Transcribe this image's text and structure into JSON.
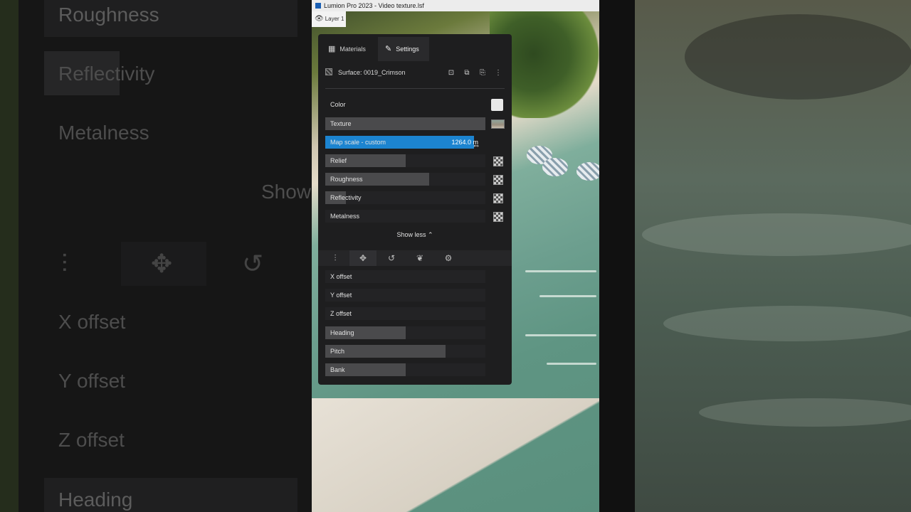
{
  "window": {
    "title": "Lumion Pro 2023 - Video texture.lsf"
  },
  "layer": {
    "label": "Layer 1"
  },
  "panel": {
    "tabs": [
      {
        "label": "Materials",
        "icon": "grid-icon"
      },
      {
        "label": "Settings",
        "icon": "pencil-icon"
      }
    ],
    "surface": {
      "name": "Surface: 0019_Crimson"
    },
    "properties": {
      "color": {
        "label": "Color"
      },
      "texture": {
        "label": "Texture"
      },
      "map_scale": {
        "label": "Map scale - custom",
        "value": "1264.0 m",
        "level": 0.93
      },
      "relief": {
        "label": "Relief",
        "level": 0.5
      },
      "roughness": {
        "label": "Roughness",
        "level": 0.65
      },
      "reflectivity": {
        "label": "Reflectivity",
        "level": 0.13
      },
      "metalness": {
        "label": "Metalness",
        "level": 0.0
      }
    },
    "show_less": "Show less",
    "transform": {
      "x_offset": {
        "label": "X offset",
        "level": 0.0
      },
      "y_offset": {
        "label": "Y offset",
        "level": 0.0
      },
      "z_offset": {
        "label": "Z offset",
        "level": 0.0
      },
      "heading": {
        "label": "Heading",
        "level": 0.5
      },
      "pitch": {
        "label": "Pitch",
        "level": 0.75
      },
      "bank": {
        "label": "Bank",
        "level": 0.5
      }
    }
  },
  "background_left": {
    "labels": [
      "Roughness",
      "Reflectivity",
      "Metalness",
      "Show",
      "X offset",
      "Y offset",
      "Z offset",
      "Heading"
    ]
  },
  "colors": {
    "accent": "#1c84d0",
    "panel": "#1e1e1f"
  }
}
